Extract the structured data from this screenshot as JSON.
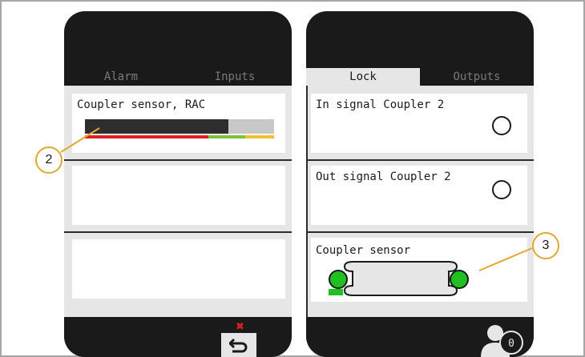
{
  "left_panel": {
    "tabs": [
      {
        "label": "Alarm",
        "active": false
      },
      {
        "label": "Inputs",
        "active": false
      }
    ],
    "sensor_card": {
      "label": "Coupler sensor, RAC",
      "level_fraction": 0.76,
      "scale_colors": [
        "#e02020",
        "#80c040",
        "#f0c030"
      ]
    },
    "error_icon": "x-mark-icon",
    "back_icon": "return-arrow-icon"
  },
  "right_panel": {
    "tabs": [
      {
        "label": "Lock",
        "active": true
      },
      {
        "label": "Outputs",
        "active": false
      }
    ],
    "in_signal": {
      "label": "In signal Coupler 2",
      "indicator": "off"
    },
    "out_signal": {
      "label": "Out signal Coupler 2",
      "indicator": "off"
    },
    "coupler_sensor": {
      "label": "Coupler sensor",
      "left_state": "on",
      "right_state": "on",
      "active_color": "#20c020"
    },
    "user_badge_count": "0"
  },
  "callouts": [
    "2",
    "3"
  ]
}
